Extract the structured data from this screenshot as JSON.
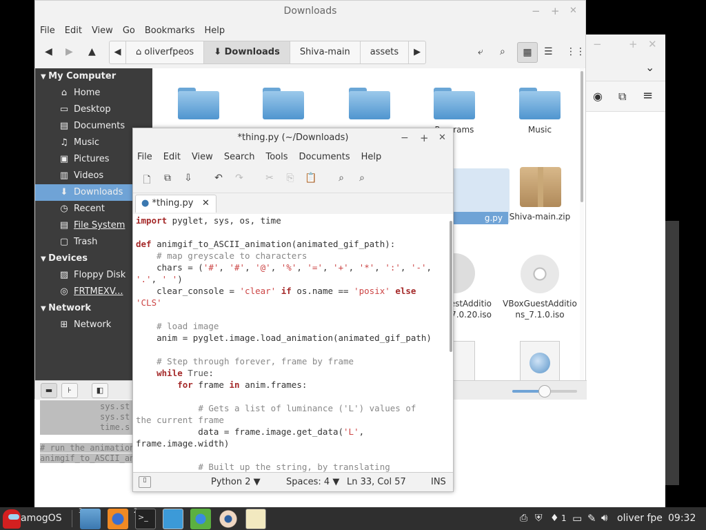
{
  "file_manager": {
    "title": "Downloads",
    "menu": [
      "File",
      "Edit",
      "View",
      "Go",
      "Bookmarks",
      "Help"
    ],
    "path": [
      "oliverfpeos",
      "Downloads",
      "Shiva-main",
      "assets"
    ],
    "sidebar": {
      "sections": [
        {
          "label": "My Computer",
          "items": [
            {
              "label": "Home",
              "icon": "home-icon"
            },
            {
              "label": "Desktop",
              "icon": "desktop-icon"
            },
            {
              "label": "Documents",
              "icon": "documents-icon"
            },
            {
              "label": "Music",
              "icon": "music-icon"
            },
            {
              "label": "Pictures",
              "icon": "pictures-icon"
            },
            {
              "label": "Videos",
              "icon": "videos-icon"
            },
            {
              "label": "Downloads",
              "icon": "download-icon",
              "selected": true
            },
            {
              "label": "Recent",
              "icon": "recent-icon"
            },
            {
              "label": "File System",
              "icon": "drive-icon"
            },
            {
              "label": "Trash",
              "icon": "trash-icon"
            }
          ]
        },
        {
          "label": "Devices",
          "items": [
            {
              "label": "Floppy Disk",
              "icon": "floppy-icon"
            },
            {
              "label": "FRTMEXV...",
              "icon": "disc-icon"
            }
          ]
        },
        {
          "label": "Network",
          "items": [
            {
              "label": "Network",
              "icon": "network-icon"
            }
          ]
        }
      ]
    },
    "files": {
      "music": "Music",
      "programs": "Programs",
      "shiva_zip": "Shiva-main.zip",
      "py_partial": "g.py",
      "vbox1_l1": "estAdditio",
      "vbox1_l2": "_7.0.20.iso",
      "vbox2_l1": "VBoxGuestAdditio",
      "vbox2_l2": "ns_7.1.0.iso"
    },
    "zoom_level": 0.5
  },
  "terminal": {
    "lines": [
      "sys.st",
      "sys.st",
      "time.s"
    ],
    "highlight_lines": [
      "# run the animation",
      "animgif_to_ASCII_an"
    ]
  },
  "editor": {
    "title": "*thing.py (~/Downloads)",
    "menu": [
      "File",
      "Edit",
      "View",
      "Search",
      "Tools",
      "Documents",
      "Help"
    ],
    "tab_label": "*thing.py",
    "status": {
      "language": "Python 2",
      "spaces": "Spaces: 4",
      "position": "Ln 33, Col 57",
      "mode": "INS"
    }
  },
  "taskbar": {
    "start_label": "amogOS",
    "badges": [
      "3",
      "2"
    ],
    "tray_text": "1",
    "user": "oliver fpe",
    "clock": "09:32"
  }
}
